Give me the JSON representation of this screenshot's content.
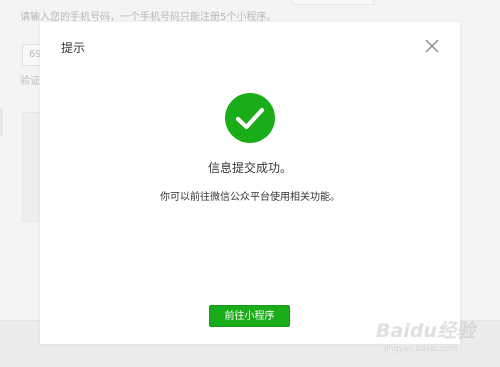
{
  "background": {
    "hint_text": "请输入您的手机号码，一个手机号码只能注册5个小程序。",
    "phone_value": "69",
    "verify_label": "验证"
  },
  "dialog": {
    "title": "提示",
    "close_icon": "close-icon",
    "status_icon": "success-check-icon",
    "message_title": "信息提交成功。",
    "message_sub": "你可以前往微信公众平台使用相关功能。",
    "primary_button": "前往小程序",
    "colors": {
      "success": "#1aad19",
      "text": "#353535"
    }
  },
  "watermark": {
    "text": "Baidu经验",
    "url": "jingyan.baidu.com"
  }
}
